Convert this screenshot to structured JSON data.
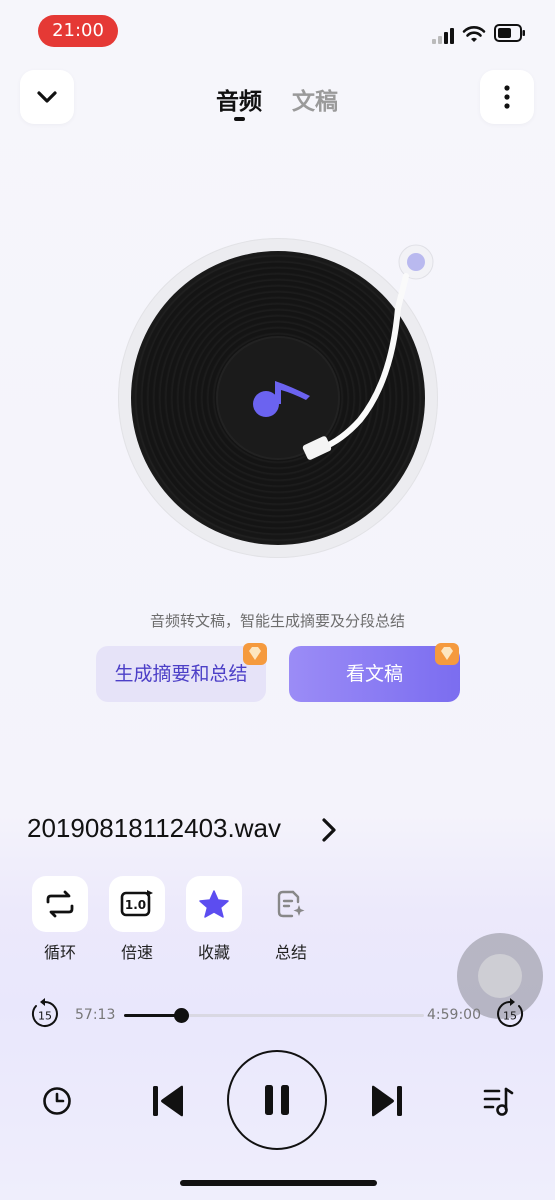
{
  "status": {
    "time": "21:00"
  },
  "header": {
    "tabs": [
      {
        "label": "音频"
      },
      {
        "label": "文稿"
      }
    ],
    "active_tab": 0
  },
  "record": {
    "icon": "music-note-icon",
    "accent": "#6b63f0"
  },
  "description": "音频转文稿，智能生成摘要及分段总结",
  "actions": {
    "summary_label": "生成摘要和总结",
    "view_label": "看文稿"
  },
  "file": {
    "name": "20190818112403.wav"
  },
  "features": [
    {
      "label": "循环",
      "icon": "loop-icon"
    },
    {
      "label": "倍速",
      "icon": "speed-icon",
      "badge": "1.0"
    },
    {
      "label": "收藏",
      "icon": "star-icon"
    },
    {
      "label": "总结",
      "icon": "summary-icon"
    }
  ],
  "player": {
    "current_time": "57:13",
    "total_time": "4:59:00",
    "progress": 0.19,
    "skip_back_seconds": "15",
    "skip_forward_seconds": "15"
  },
  "colors": {
    "accent": "#6b63f0",
    "status_pill": "#e53935"
  }
}
